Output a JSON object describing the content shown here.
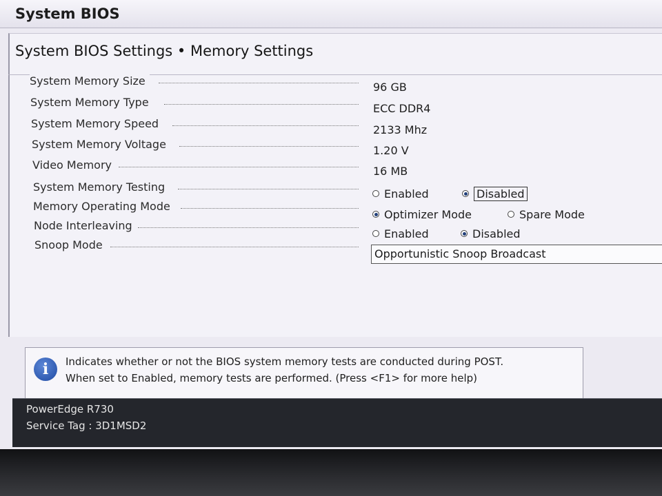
{
  "window": {
    "title": "System BIOS"
  },
  "page": {
    "title": "System BIOS Settings • Memory Settings"
  },
  "settings": [
    {
      "label": "System Memory Size",
      "value": "96 GB"
    },
    {
      "label": "System Memory Type",
      "value": "ECC DDR4"
    },
    {
      "label": "System Memory Speed",
      "value": "2133 Mhz"
    },
    {
      "label": "System Memory Voltage",
      "value": "1.20 V"
    },
    {
      "label": "Video Memory",
      "value": "16 MB"
    }
  ],
  "memory_testing": {
    "label": "System Memory Testing",
    "options": [
      "Enabled",
      "Disabled"
    ],
    "selected": "Disabled"
  },
  "operating_mode": {
    "label": "Memory Operating Mode",
    "options": [
      "Optimizer Mode",
      "Spare Mode"
    ],
    "selected": "Optimizer Mode"
  },
  "node_interleaving": {
    "label": "Node Interleaving",
    "options": [
      "Enabled",
      "Disabled"
    ],
    "selected": "Disabled"
  },
  "snoop_mode": {
    "label": "Snoop Mode",
    "value": "Opportunistic Snoop Broadcast"
  },
  "help": {
    "icon": "info-icon",
    "line1": "Indicates whether or not the BIOS system memory tests are conducted during POST.",
    "line2": "When set to Enabled, memory tests are performed. (Press <F1> for more help)"
  },
  "footer": {
    "model": "PowerEdge R730",
    "service_tag": "Service Tag : 3D1MSD2"
  },
  "colors": {
    "screen_bg": "#eceaf2",
    "footer_bg": "#24262c",
    "accent": "#1f4aa3"
  }
}
